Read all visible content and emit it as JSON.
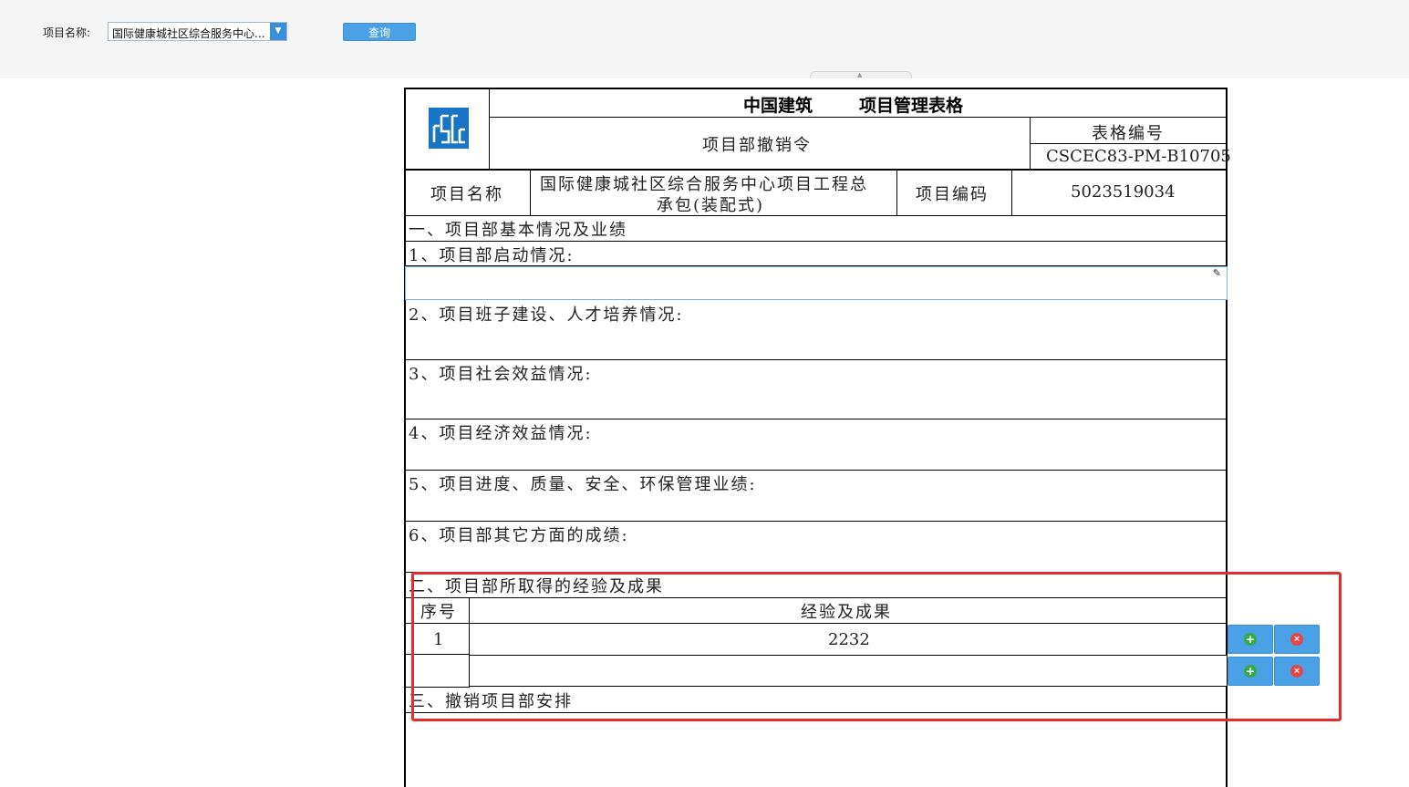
{
  "toolbar": {
    "project_label": "项目名称:",
    "project_select_value": "国际健康城社区综合服务中心...",
    "query_button": "查询",
    "collapse_glyph": "▲"
  },
  "form": {
    "company": "中国建筑",
    "header_title": "项目管理表格",
    "form_name": "项目部撤销令",
    "form_code_label": "表格编号",
    "form_code_value": "CSCEC83-PM-B10705",
    "project_name_label": "项目名称",
    "project_name_line1": "国际健康城社区综合服务中心项目工程总",
    "project_name_line2": "承包(装配式)",
    "project_code_label": "项目编码",
    "project_code_value": "5023519034",
    "section1": "一、项目部基本情况及业绩",
    "item1": "1、项目部启动情况:",
    "item2": "2、项目班子建设、人才培养情况:",
    "item3": "3、项目社会效益情况:",
    "item4": "4、项目经济效益情况:",
    "item5": "5、项目进度、质量、安全、环保管理业绩:",
    "item6": "6、项目部其它方面的成绩:",
    "section2": "二、项目部所取得的经验及成果",
    "col_seq": "序号",
    "col_result": "经验及成果",
    "rows": [
      {
        "seq": "1",
        "result": "2232"
      },
      {
        "seq": "",
        "result": ""
      }
    ],
    "section3": "三、撤销项目部安排"
  },
  "icons": {
    "add": "+",
    "delete": "×",
    "pencil": "✎"
  },
  "colors": {
    "accent": "#4aa1e6",
    "highlight": "#e52c2c",
    "add": "#38a84a",
    "delete": "#e04848"
  }
}
